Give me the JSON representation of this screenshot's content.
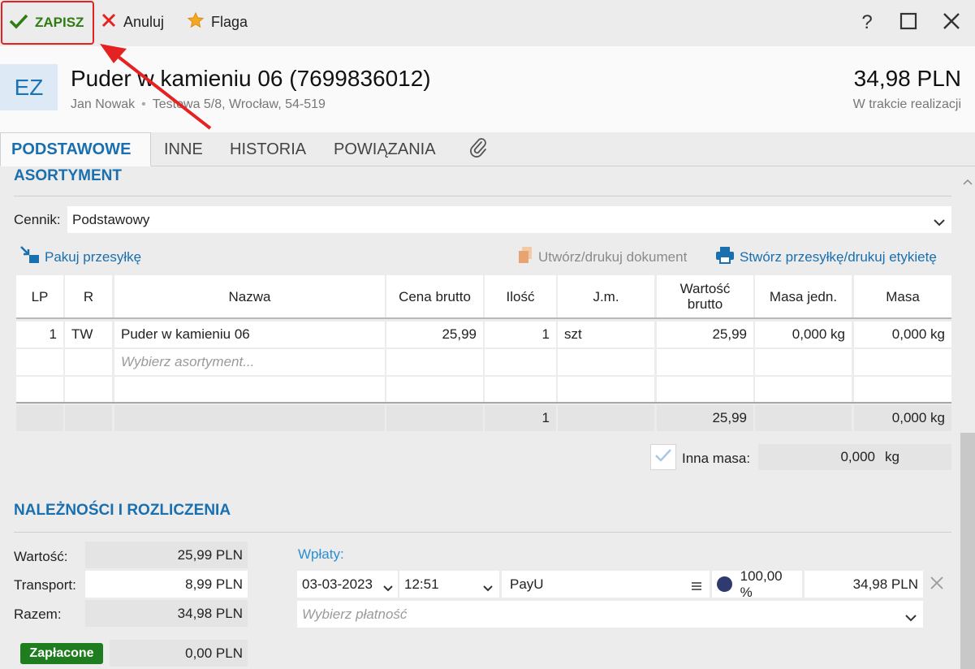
{
  "toolbar": {
    "save_label": "ZAPISZ",
    "cancel_label": "Anuluj",
    "flag_label": "Flaga",
    "help_label": "?"
  },
  "header": {
    "badge": "EZ",
    "title": "Puder w kamieniu 06 (7699836012)",
    "customer": "Jan Nowak",
    "address": "Testowa 5/8, Wrocław, 54-519",
    "amount": "34,98 PLN",
    "status": "W trakcie realizacji"
  },
  "tabs": [
    {
      "label": "PODSTAWOWE"
    },
    {
      "label": "INNE"
    },
    {
      "label": "HISTORIA"
    },
    {
      "label": "POWIĄZANIA"
    }
  ],
  "assortment": {
    "title": "ASORTYMENT",
    "price_list_label": "Cennik:",
    "price_list_value": "Podstawowy",
    "pack_link": "Pakuj przesyłkę",
    "create_doc_link": "Utwórz/drukuj dokument",
    "create_shipment_link": "Stwórz przesyłkę/drukuj etykietę",
    "columns": [
      "LP",
      "R",
      "Nazwa",
      "Cena brutto",
      "Ilość",
      "J.m.",
      "Wartość brutto",
      "Masa jedn.",
      "Masa"
    ],
    "rows": [
      {
        "lp": "1",
        "r": "TW",
        "name": "Puder w kamieniu 06",
        "price": "25,99",
        "qty": "1",
        "unit": "szt",
        "value": "25,99",
        "unit_mass": "0,000 kg",
        "mass": "0,000 kg"
      }
    ],
    "new_row_placeholder": "Wybierz asortyment...",
    "totals": {
      "qty": "1",
      "value": "25,99",
      "mass": "0,000 kg"
    },
    "other_mass_label": "Inna masa:",
    "other_mass_value": "0,000",
    "other_mass_unit": "kg"
  },
  "payments": {
    "title": "NALEŻNOŚCI I ROZLICZENIA",
    "value_label": "Wartość:",
    "value": "25,99 PLN",
    "transport_label": "Transport:",
    "transport": "8,99 PLN",
    "total_label": "Razem:",
    "total": "34,98 PLN",
    "paid_badge": "Zapłacone",
    "paid_value": "0,00 PLN",
    "deposits_label": "Wpłaty:",
    "entry": {
      "date": "03-03-2023",
      "time": "12:51",
      "method": "PayU",
      "percent": "100,00 %",
      "amount": "34,98 PLN"
    },
    "choose_payment_placeholder": "Wybierz płatność"
  },
  "colors": {
    "accent": "#1a6fae",
    "save_green": "#2e7d12",
    "highlight_red": "#e52222",
    "paid_green": "#1e7d1e"
  }
}
